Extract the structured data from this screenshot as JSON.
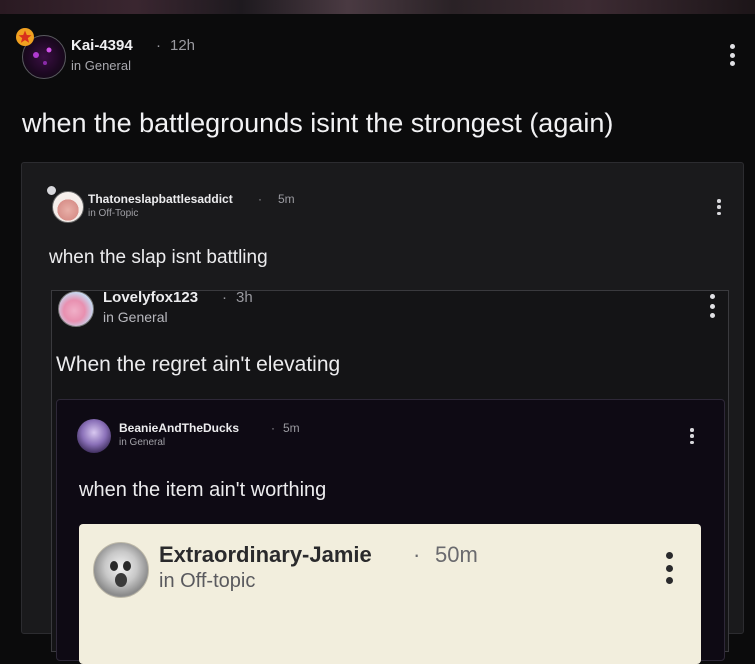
{
  "post": {
    "author": "Kai-4394",
    "time": "12h",
    "category": "in General",
    "title": "when the battlegrounds isint the strongest (again)"
  },
  "quote1": {
    "author": "Thatoneslapbattlesaddict",
    "time": "5m",
    "category": "in Off-Topic",
    "text": "when the slap isnt battling"
  },
  "quote2": {
    "author": "Lovelyfox123",
    "time": "3h",
    "category": "in General",
    "text": "When the regret ain't elevating"
  },
  "quote3": {
    "author": "BeanieAndTheDucks",
    "time": "5m",
    "category": "in General",
    "text": "when the item ain't worthing"
  },
  "quote4": {
    "author": "Extraordinary-Jamie",
    "time": "50m",
    "category": "in Off-topic"
  },
  "separator": "·",
  "icons": {
    "badge": "star-badge-icon",
    "menu": "more-vertical-icon"
  },
  "colors": {
    "background": "#0b0b0c",
    "badge": "#f0a020",
    "light_card": "#f2eedd"
  }
}
